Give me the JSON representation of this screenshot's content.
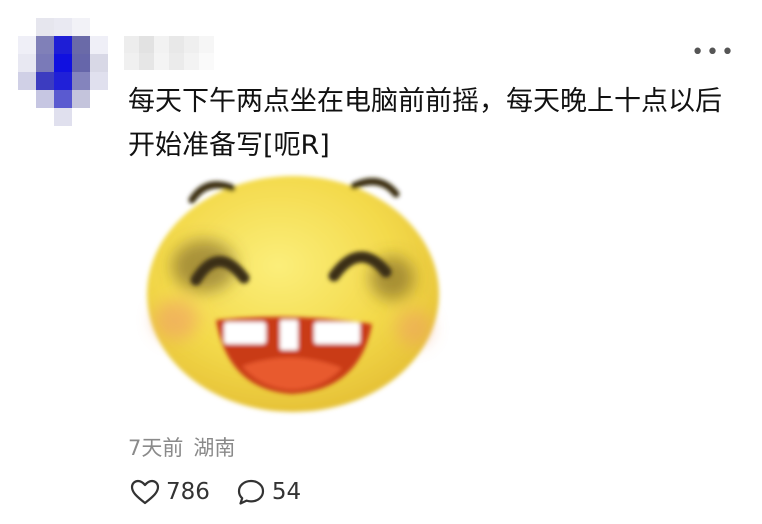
{
  "comment": {
    "text": "每天下午两点坐在电脑前前摇，每天晚上十点以后开始准备写[呃R]",
    "time": "7天前",
    "location": "湖南",
    "likes": "786",
    "replies": "54"
  },
  "sticker": {
    "name": "laughing-emoji-sticker"
  },
  "icons": {
    "more": "more-options-icon",
    "like": "heart-icon",
    "reply": "comment-bubble-icon"
  },
  "colors": {
    "avatar_pixels": [
      "#ffffff",
      "#e6e6ee",
      "#e9e9f2",
      "#f2f2f7",
      "#ffffff",
      "#efeff7",
      "#8080b8",
      "#1e1ed6",
      "#6a6aa8",
      "#efeff7",
      "#e8e8f2",
      "#7a7ab8",
      "#1010e0",
      "#6666aa",
      "#d8d8e6",
      "#d0d0e6",
      "#3c3cc0",
      "#2020d8",
      "#8484bd",
      "#e0e0ee",
      "#ffffff",
      "#c6c6e2",
      "#5a5ad0",
      "#c4c4dc",
      "#ffffff",
      "#ffffff",
      "#ffffff",
      "#e0e0ee",
      "#ffffff",
      "#ffffff"
    ],
    "username_pixels": [
      "#ededed",
      "#e2e2e2",
      "#f2f2f2",
      "#e8e8e8",
      "#efefef",
      "#f6f6f6",
      "#f0f0f0",
      "#e6e6e6",
      "#f4f4f4",
      "#ebebeb",
      "#f3f3f3",
      "#fafafa"
    ],
    "text": "#111111",
    "meta": "#8a8a8a",
    "sticker_face": "#f5dc4c"
  }
}
